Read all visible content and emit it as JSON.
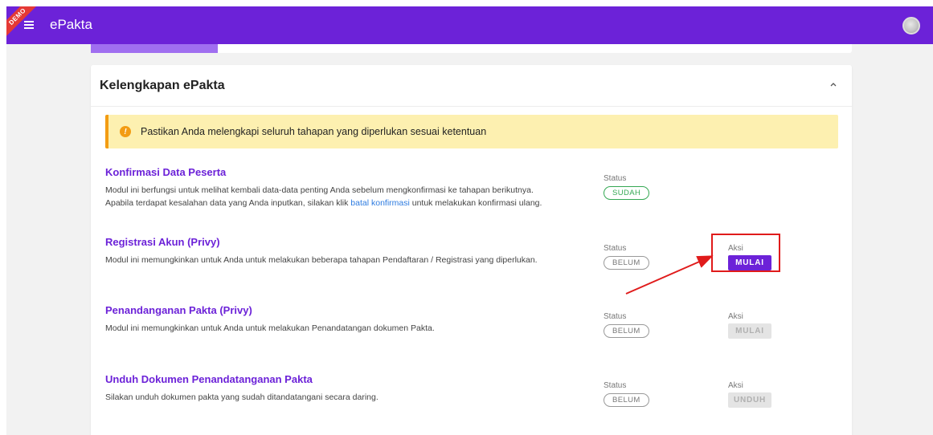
{
  "header": {
    "ribbon": "DEMO",
    "brand": "ePakta"
  },
  "card": {
    "title": "Kelengkapan ePakta"
  },
  "alert": {
    "text": "Pastikan Anda melengkapi seluruh tahapan yang diperlukan sesuai ketentuan",
    "icon_glyph": "!"
  },
  "modules": [
    {
      "title": "Konfirmasi Data Peserta",
      "desc_line1": "Modul ini berfungsi untuk melihat kembali data-data penting Anda sebelum mengkonfirmasi ke tahapan berikutnya.",
      "desc_line2_pre": "Apabila terdapat kesalahan data yang Anda inputkan, silakan klik ",
      "desc_link": "batal konfirmasi",
      "desc_line2_post": " untuk melakukan konfirmasi ulang.",
      "status_label": "Status",
      "status": "SUDAH"
    },
    {
      "title": "Registrasi Akun (Privy)",
      "desc": "Modul ini memungkinkan untuk Anda untuk melakukan beberapa tahapan Pendaftaran / Registrasi yang diperlukan.",
      "status_label": "Status",
      "status": "BELUM",
      "action_label": "Aksi",
      "action": "MULAI"
    },
    {
      "title": "Penandanganan Pakta (Privy)",
      "desc": "Modul ini memungkinkan untuk Anda untuk melakukan Penandatangan dokumen Pakta.",
      "status_label": "Status",
      "status": "BELUM",
      "action_label": "Aksi",
      "action": "MULAI"
    },
    {
      "title": "Unduh Dokumen Penandatanganan Pakta",
      "desc": "Silakan unduh dokumen pakta yang sudah ditandatangani secara daring.",
      "status_label": "Status",
      "status": "BELUM",
      "action_label": "Aksi",
      "action": "UNDUH"
    }
  ],
  "colors": {
    "brand": "#6c22d8",
    "success": "#34a853",
    "warning": "#f39c12",
    "alert_bg": "#fdf0b0",
    "annotation": "#e01b1b",
    "link": "#2d7be0"
  },
  "icons": {
    "menu": "hamburger-icon",
    "avatar": "user-avatar",
    "collapse": "chevron-up-icon",
    "alert": "info-icon"
  }
}
